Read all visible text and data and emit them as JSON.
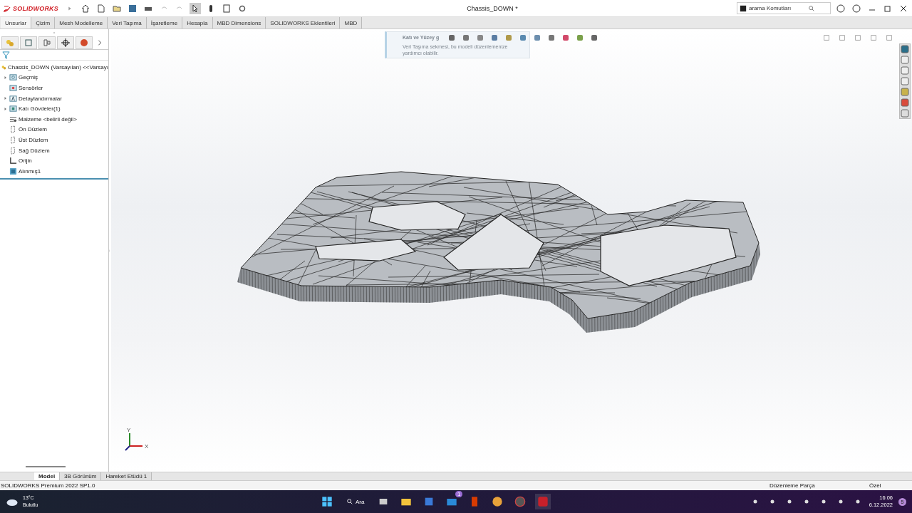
{
  "app": {
    "logo": "SOLIDWORKS",
    "title": "Chassis_DOWN *",
    "search": {
      "placeholder": "arama Komutları"
    }
  },
  "command_tabs": [
    {
      "label": "Unsurlar",
      "selected": true
    },
    {
      "label": "Çizim",
      "selected": false
    },
    {
      "label": "Mesh Modelleme",
      "selected": false
    },
    {
      "label": "Veri Taşıma",
      "selected": false
    },
    {
      "label": "İşaretleme",
      "selected": false
    },
    {
      "label": "Hesapla",
      "selected": false
    },
    {
      "label": "MBD Dimensions",
      "selected": false
    },
    {
      "label": "SOLIDWORKS Eklentileri",
      "selected": false
    },
    {
      "label": "MBD",
      "selected": false
    }
  ],
  "feature_tree": {
    "items": [
      {
        "label": "Chassis_DOWN (Varsayılan) <<Varsayı",
        "kind": "part"
      },
      {
        "label": "Geçmiş",
        "kind": "history",
        "expandable": true
      },
      {
        "label": "Sensörler",
        "kind": "sensor",
        "expandable": false
      },
      {
        "label": "Detaylandırmalar",
        "kind": "annotation",
        "expandable": true
      },
      {
        "label": "Katı Gövdeler(1)",
        "kind": "bodies",
        "expandable": true
      },
      {
        "label": "Malzeme <belirli değil>",
        "kind": "material",
        "expandable": false
      },
      {
        "label": "Ön Düzlem",
        "kind": "plane",
        "expandable": false
      },
      {
        "label": "Üst Düzlem",
        "kind": "plane",
        "expandable": false
      },
      {
        "label": "Sağ Düzlem",
        "kind": "plane",
        "expandable": false
      },
      {
        "label": "Orijin",
        "kind": "origin",
        "expandable": false
      },
      {
        "label": "Alınmış1",
        "kind": "imported",
        "expandable": false
      }
    ]
  },
  "tooltip": {
    "title": "Katı ve Yüzey g",
    "body": "Veri Taşıma sekmesi, bu modeli düzenlemenize yardımcı olabilir."
  },
  "triad": {
    "y": "Y",
    "x": "X"
  },
  "bottom_tabs": [
    {
      "label": "Model",
      "selected": true
    },
    {
      "label": "3B Görünüm",
      "selected": false
    },
    {
      "label": "Hareket Etüdü 1",
      "selected": false
    }
  ],
  "status_bar": {
    "version": "SOLIDWORKS Premium 2022 SP1.0",
    "mode": "Düzenleme Parça",
    "units": "Özel"
  },
  "taskbar": {
    "temperature": "13°C",
    "weather": "Bulutlu",
    "search": "Ara",
    "badge": "1",
    "time": "16:06",
    "date": "6.12.2022",
    "notifications": "5"
  }
}
